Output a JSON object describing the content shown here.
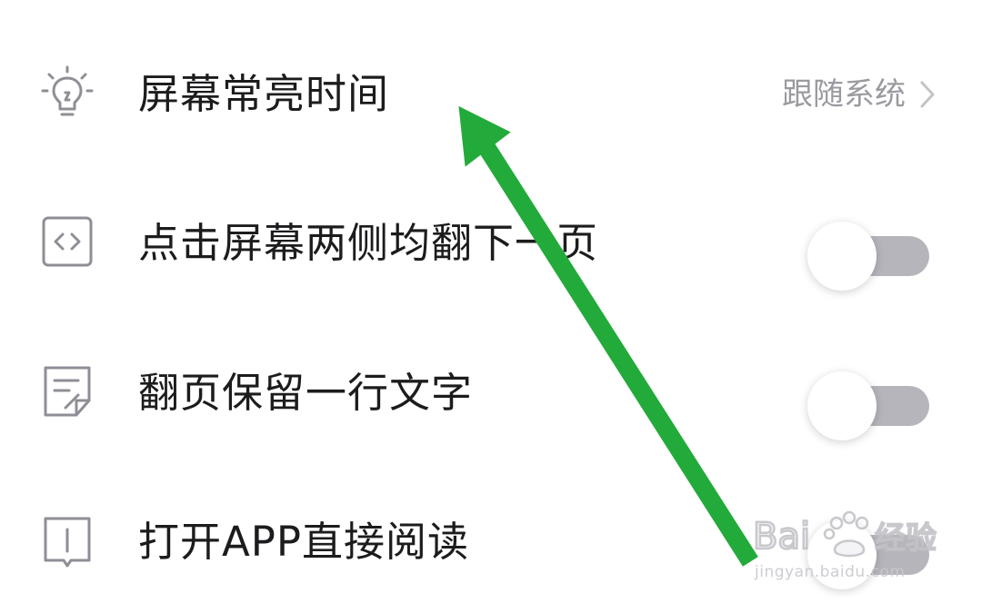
{
  "settings": [
    {
      "icon": "lightbulb-icon",
      "label": "屏幕常亮时间",
      "value": "跟随系统",
      "control": "chevron"
    },
    {
      "icon": "code-brackets-icon",
      "label": "点击屏幕两侧均翻下一页",
      "control": "toggle",
      "on": false
    },
    {
      "icon": "note-edit-icon",
      "label": "翻页保留一行文字",
      "control": "toggle",
      "on": false
    },
    {
      "icon": "book-icon",
      "label": "打开APP直接阅读",
      "control": "toggle",
      "on": false
    }
  ],
  "colors": {
    "label": "#1c1c1e",
    "value": "#9a9aa0",
    "icon": "#8e8e96",
    "toggle_off_track": "#b5b5bb",
    "annotation_arrow": "#22aa3a"
  },
  "watermark": {
    "brand": "Baidu经验",
    "url": "jingyan.baidu.com"
  }
}
